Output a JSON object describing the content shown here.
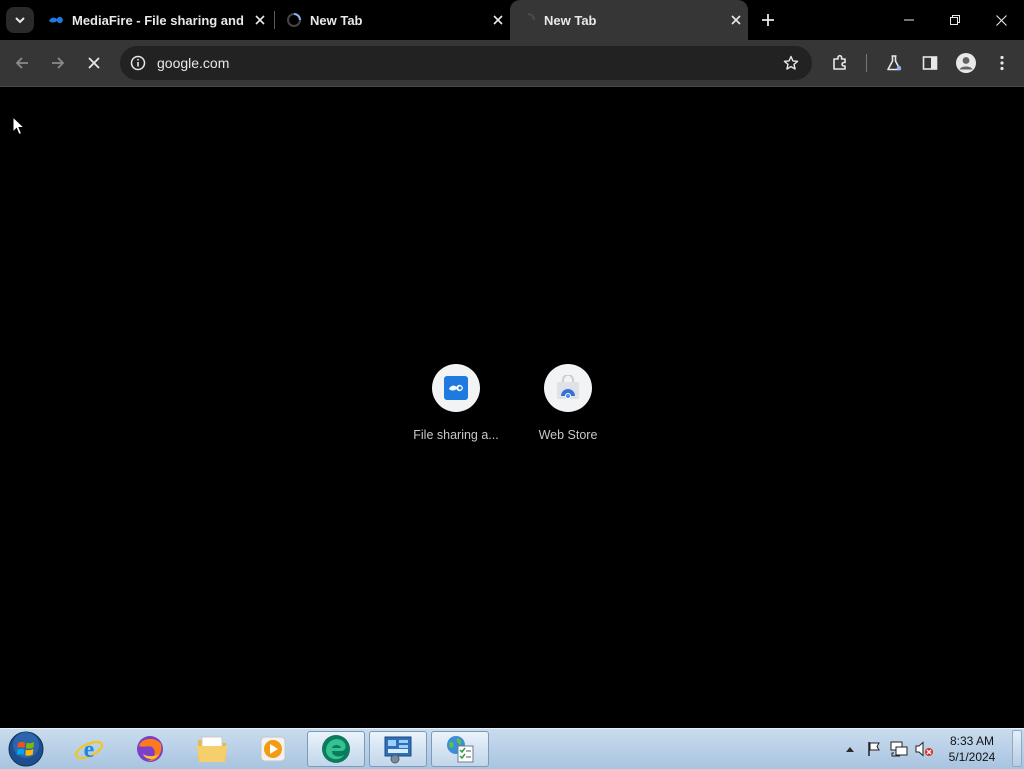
{
  "browser": {
    "tabs": [
      {
        "title": "MediaFire - File sharing and storage made simple",
        "favicon": "mediafire-icon",
        "active": false
      },
      {
        "title": "New Tab",
        "favicon": "loading-spinner-icon",
        "active": false
      },
      {
        "title": "New Tab",
        "favicon": "loading-spinner-icon",
        "active": true
      }
    ],
    "address": "google.com"
  },
  "shortcuts": [
    {
      "label": "File sharing a...",
      "icon": "mediafire-icon"
    },
    {
      "label": "Web Store",
      "icon": "web-store-icon"
    }
  ],
  "taskbar": {
    "clock": {
      "time": "8:33 AM",
      "date": "5/1/2024"
    }
  },
  "colors": {
    "tab_strip": "#000000",
    "toolbar": "#363636",
    "omnibox": "#222222",
    "mediafire_blue": "#1f7ae0",
    "taskbar": "#b8cfe6"
  }
}
